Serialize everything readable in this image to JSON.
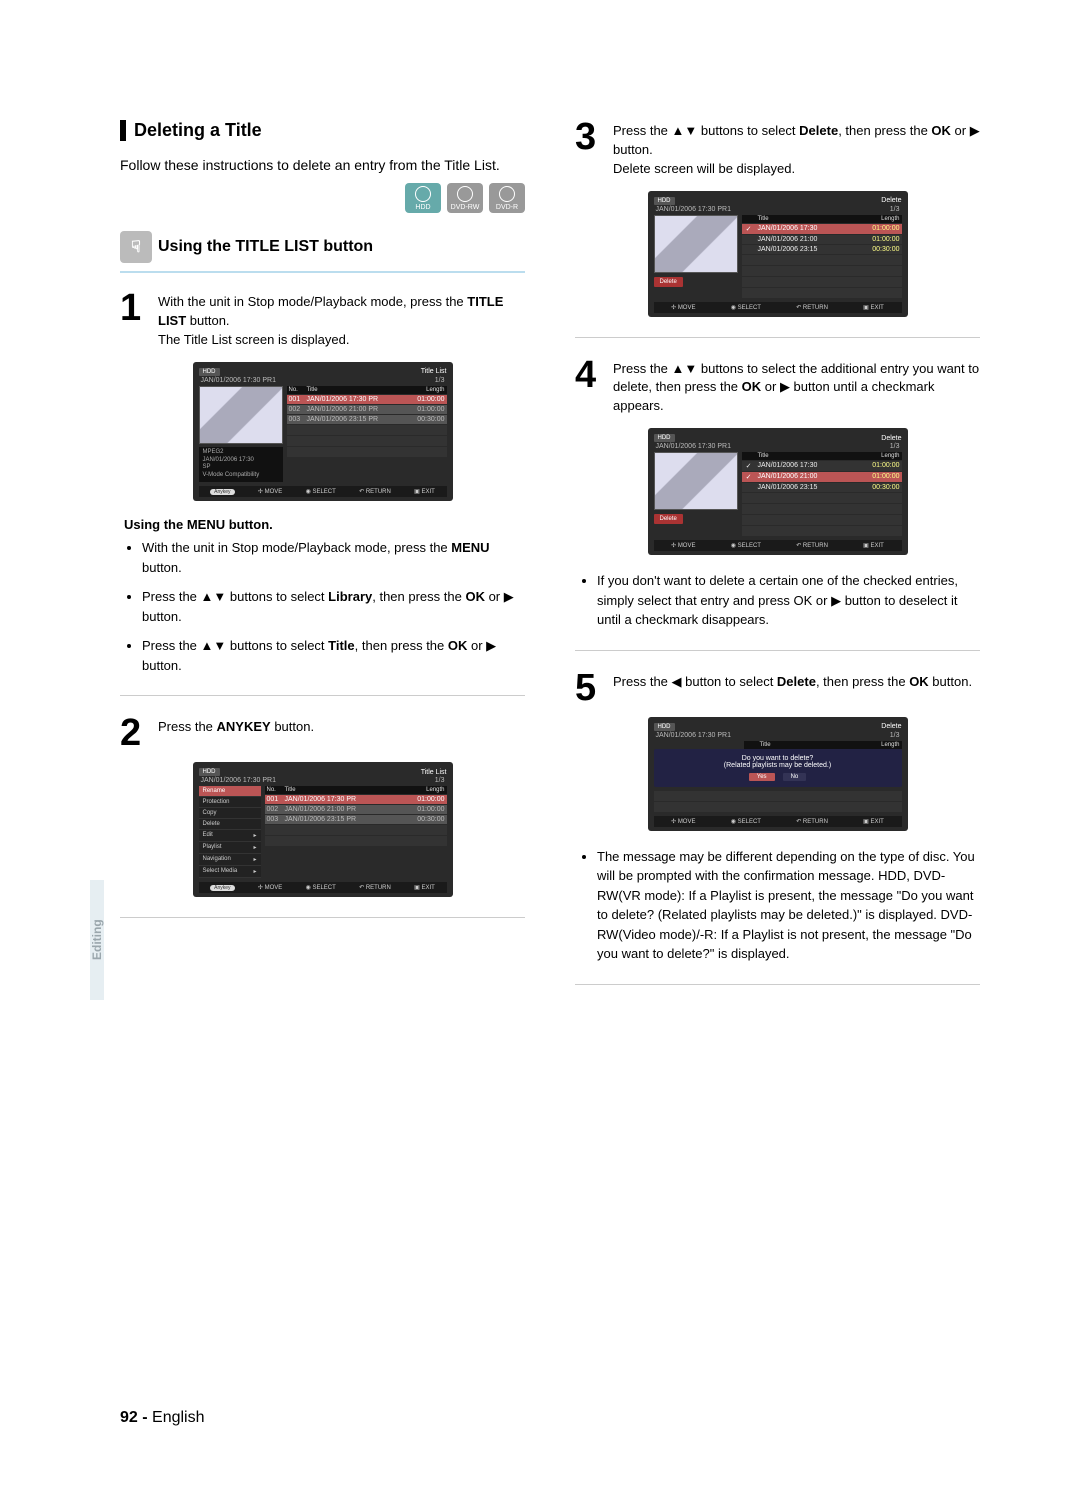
{
  "sidebar_label": "Editing",
  "page_footer": {
    "num": "92 -",
    "lang": "English"
  },
  "section_title": "Deleting a Title",
  "intro": "Follow these instructions to delete an entry from the Title List.",
  "disc_icons": [
    "HDD",
    "DVD-RW",
    "DVD-R"
  ],
  "subsection": "Using the TITLE LIST button",
  "steps": {
    "s1": {
      "text_a": "With the unit in Stop mode/Playback mode, press the ",
      "bold": "TITLE LIST",
      "text_b": " button.",
      "sub": "The Title List screen is displayed."
    },
    "s2": {
      "text_a": "Press the ",
      "bold": "ANYKEY",
      "text_b": " button."
    },
    "s3": {
      "text_a": "Press the ▲▼ buttons to select ",
      "bold1": "Delete",
      "mid": ", then press the ",
      "bold2": "OK",
      "text_b": " or ▶ button.",
      "sub": "Delete screen will be displayed."
    },
    "s4": {
      "text": "Press the ▲▼ buttons to select the additional entry you want to delete, then press the ",
      "bold": "OK",
      "text_b": " or ▶ button until a checkmark appears."
    },
    "s5": {
      "text_a": "Press the ◀ button to select ",
      "bold1": "Delete",
      "mid": ", then press the ",
      "bold2": "OK",
      "text_b": " button."
    }
  },
  "menu_heading": "Using the MENU button.",
  "menu_bullets": [
    {
      "a": "With the unit in Stop mode/Playback mode, press the ",
      "b": "MENU",
      "c": " button."
    },
    {
      "a": "Press the ▲▼ buttons to select ",
      "b": "Library",
      "c": ", then press the ",
      "d": "OK",
      "e": " or ▶ button."
    },
    {
      "a": "Press the ▲▼ buttons to select ",
      "b": "Title",
      "c": ", then press the ",
      "d": "OK",
      "e": " or ▶ button."
    }
  ],
  "note_after_s4": "If you don't want to delete a certain one of the checked entries, simply select that entry and press OK or ▶ button to deselect it until a checkmark disappears.",
  "note_after_s5": "The message may be different depending on the type of disc. You will be prompted with the confirmation message. HDD, DVD-RW(VR mode): If a Playlist is present, the message \"Do you want to delete? (Related playlists may be deleted.)\" is displayed. DVD-RW(Video mode)/-R: If a Playlist is not present, the message \"Do you want to delete?\" is displayed.",
  "osd_common": {
    "hdd": "HDD",
    "datetime": "JAN/01/2006 17:30 PR1",
    "page": "1/3",
    "foot": {
      "move": "MOVE",
      "select": "SELECT",
      "return": "RETURN",
      "exit": "EXIT"
    },
    "anykey": "Anykey"
  },
  "osd1": {
    "title": "Title List",
    "cols": [
      "No.",
      "Title",
      "Length"
    ],
    "rows": [
      {
        "no": "001",
        "title": "JAN/01/2006 17:30 PR",
        "len": "01:00:00"
      },
      {
        "no": "002",
        "title": "JAN/01/2006 21:00 PR",
        "len": "01:00:00"
      },
      {
        "no": "003",
        "title": "JAN/01/2006 23:15 PR",
        "len": "00:30:00"
      }
    ],
    "info": [
      "MPEG2",
      "JAN/01/2006 17:30",
      "SP",
      "V-Mode Compatibility"
    ]
  },
  "osd2": {
    "title": "Title List",
    "menu": [
      "Rename",
      "Protection",
      "Copy",
      "Delete",
      "Edit",
      "Playlist",
      "Navigation",
      "Select Media"
    ],
    "cols": [
      "No.",
      "Title",
      "Length"
    ],
    "rows": [
      {
        "no": "001",
        "title": "JAN/01/2006 17:30 PR",
        "len": "01:00:00"
      },
      {
        "no": "002",
        "title": "JAN/01/2006 21:00 PR",
        "len": "01:00:00"
      },
      {
        "no": "003",
        "title": "JAN/01/2006 23:15 PR",
        "len": "00:30:00"
      }
    ]
  },
  "osd3": {
    "title": "Delete",
    "btn": "Delete",
    "cols": [
      "Title",
      "Length"
    ],
    "rows": [
      {
        "ck": "✓",
        "title": "JAN/01/2006 17:30",
        "len": "01:00:00"
      },
      {
        "ck": "",
        "title": "JAN/01/2006 21:00",
        "len": "01:00:00"
      },
      {
        "ck": "",
        "title": "JAN/01/2006 23:15",
        "len": "00:30:00"
      }
    ]
  },
  "osd4": {
    "title": "Delete",
    "btn": "Delete",
    "cols": [
      "Title",
      "Length"
    ],
    "rows": [
      {
        "ck": "✓",
        "title": "JAN/01/2006 17:30",
        "len": "01:00:00"
      },
      {
        "ck": "✓",
        "title": "JAN/01/2006 21:00",
        "len": "01:00:00"
      },
      {
        "ck": "",
        "title": "JAN/01/2006 23:15",
        "len": "00:30:00"
      }
    ]
  },
  "osd5": {
    "title": "Delete",
    "cols": [
      "Title",
      "Length"
    ],
    "dialog": {
      "line1": "Do you want to delete?",
      "line2": "(Related playlists may be deleted.)",
      "yes": "Yes",
      "no": "No"
    }
  }
}
